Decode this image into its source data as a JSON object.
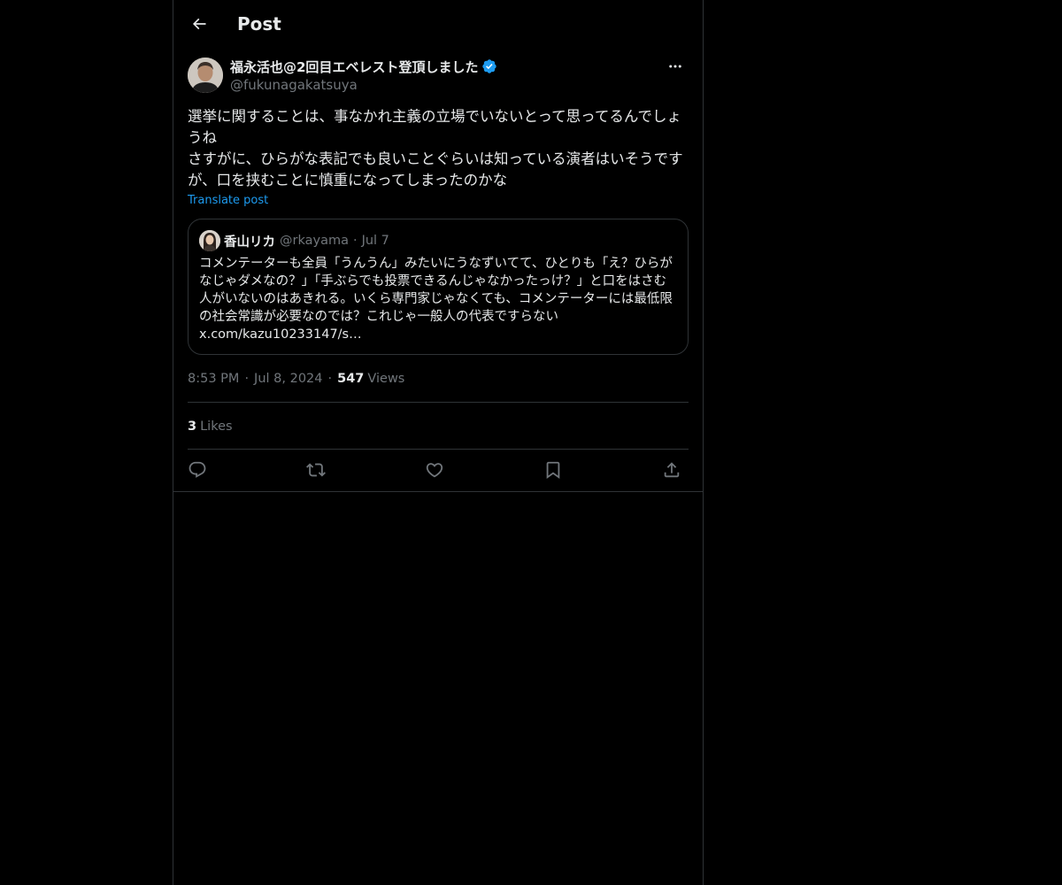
{
  "header": {
    "title": "Post"
  },
  "post": {
    "author_name": "福永活也@2回目エベレスト登頂しました",
    "author_handle": "@fukunagakatsuya",
    "text_lines": [
      "選挙に関することは、事なかれ主義の立場でいないとって思ってるんでしょうね",
      "さすがに、ひらがな表記でも良いことぐらいは知っている演者はいそうですが、口を挟むことに慎重になってしまったのかな"
    ],
    "translate_label": "Translate post",
    "time": "8:53 PM",
    "date": "Jul 8, 2024",
    "views_count": "547",
    "views_label": "Views",
    "likes_count": "3",
    "likes_label": "Likes"
  },
  "quote": {
    "author_name": "香山リカ",
    "author_handle": "@rkayama",
    "date": "Jul 7",
    "text": "コメンテーターも全員「うんうん」みたいにうなずいてて、ひとりも「え？ひらがなじゃダメなの？」「手ぶらでも投票できるんじゃなかったっけ？」と口をはさむ人がいないのはあきれる。いくら専門家じゃなくても、コメンテーターには最低限の社会常識が必要なのでは？これじゃ一般人の代表ですらない",
    "link": "x.com/kazu10233147/s…"
  },
  "separators": {
    "dot": "·"
  },
  "icons": {
    "back": "arrow-left-icon",
    "verified": "verified-badge-icon",
    "more": "more-horizontal-icon",
    "reply": "reply-icon",
    "repost": "repost-icon",
    "like": "heart-icon",
    "bookmark": "bookmark-icon",
    "share": "share-icon"
  },
  "colors": {
    "background": "#000000",
    "text_primary": "#e7e9ea",
    "text_secondary": "#71767b",
    "link": "#1d9bf0",
    "border": "#2f3336",
    "verified": "#1d9bf0"
  }
}
